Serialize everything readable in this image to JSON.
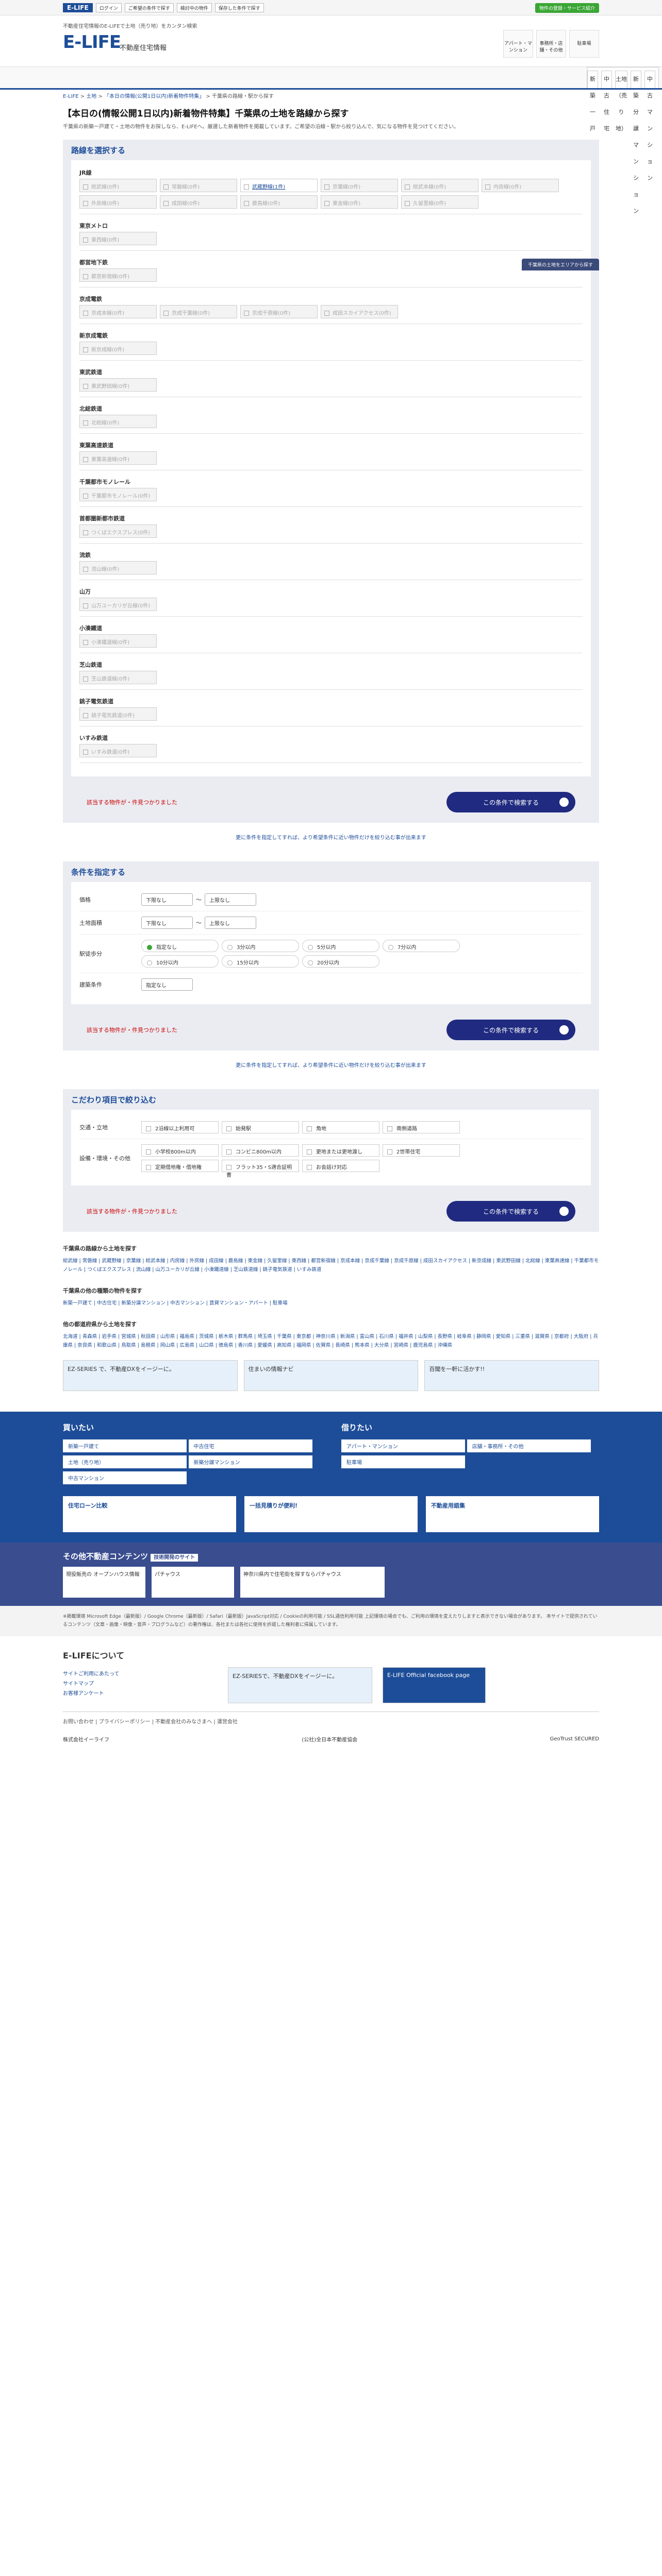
{
  "topbar": {
    "logo": "E-LIFE",
    "btn1": "ログイン",
    "btn2": "ご希望の条件で探す",
    "btn3": "検討中の物件",
    "btn4": "保存した条件で探す",
    "right": "物件の登録・サービス紹介"
  },
  "header": {
    "desc": "不動産住宅情報のE-LIFEで土地（売り地）をカンタン検索",
    "logo": "E-LIFE",
    "sub": "不動産住宅情報",
    "nav": [
      "アパート・マンション",
      "事務所・店舗・その他",
      "駐車場"
    ]
  },
  "gnav": [
    "新築一戸建て",
    "中古住宅",
    "土地（売り地）",
    "新築分譲マンション",
    "中古マンション"
  ],
  "breadcrumb": {
    "home": "E-LIFE",
    "b2": "土地",
    "b3": "「本日の情報(公開1日以内)新着物件特集」",
    "b4": "千葉県の路線・駅から探す"
  },
  "title": "【本日の(情報公開1日以内)新着物件特集】千葉県の土地を路線から探す",
  "lead": "千葉県の新築一戸建て・土地の物件をお探しなら、E-LIFEへ。厳選した新着物件を掲載しています。ご希望の沿線・駅から絞り込んで、気になる物件を見つけてください。",
  "area_link": "千葉県の土地をエリアから探す",
  "line_section": {
    "title": "路線を選択する",
    "lines": [
      {
        "name": "JR線",
        "stations": [
          "総武線(0件)",
          "常磐線(0件)",
          "武蔵野線(1件)",
          "京葉線(0件)",
          "総武本線(0件)",
          "内房線(0件)",
          "外房線(0件)",
          "成田線(0件)",
          "鹿島線(0件)",
          "東金線(0件)",
          "久留里線(0件)"
        ]
      },
      {
        "name": "東京メトロ",
        "stations": [
          "東西線(0件)"
        ]
      },
      {
        "name": "都営地下鉄",
        "stations": [
          "都営新宿線(0件)"
        ]
      },
      {
        "name": "京成電鉄",
        "stations": [
          "京成本線(0件)",
          "京成千葉線(0件)",
          "京成千原線(0件)",
          "成田スカイアクセス(0件)"
        ]
      },
      {
        "name": "新京成電鉄",
        "stations": [
          "新京成線(0件)"
        ]
      },
      {
        "name": "東武鉄道",
        "stations": [
          "東武野田線(0件)"
        ]
      },
      {
        "name": "北総鉄道",
        "stations": [
          "北総線(0件)"
        ]
      },
      {
        "name": "東葉高速鉄道",
        "stations": [
          "東葉高速線(0件)"
        ]
      },
      {
        "name": "千葉都市モノレール",
        "stations": [
          "千葉都市モノレール(0件)"
        ]
      },
      {
        "name": "首都圏新都市鉄道",
        "stations": [
          "つくばエクスプレス(0件)"
        ]
      },
      {
        "name": "流鉄",
        "stations": [
          "流山線(0件)"
        ]
      },
      {
        "name": "山万",
        "stations": [
          "山万ユーカリが丘線(0件)"
        ]
      },
      {
        "name": "小湊鐵道",
        "stations": [
          "小湊鐵道線(0件)"
        ]
      },
      {
        "name": "芝山鉄道",
        "stations": [
          "芝山鉄道線(0件)"
        ]
      },
      {
        "name": "銚子電気鉄道",
        "stations": [
          "銚子電気鉄道(0件)"
        ]
      },
      {
        "name": "いすみ鉄道",
        "stations": [
          "いすみ鉄道(0件)"
        ]
      }
    ]
  },
  "result_text": "該当する物件が・件見つかりました",
  "search_btn": "この条件で検索する",
  "hint": "更に条件を指定してすれば、より希望条件に近い物件だけを絞り込む事が出来ます",
  "cond_section": {
    "title": "条件を指定する",
    "price_label": "価格",
    "price_from": "下限なし",
    "price_to": "上限なし",
    "area_label": "土地面積",
    "area_from": "下限なし",
    "area_to": "上限なし",
    "walk_label": "駅徒歩分",
    "walk_options": [
      "指定なし",
      "3分以内",
      "5分以内",
      "7分以内",
      "10分以内",
      "15分以内",
      "20分以内"
    ],
    "build_label": "建築条件",
    "build_val": "指定なし"
  },
  "kodawari": {
    "title": "こだわり項目で絞り込む",
    "label1": "交通・立地",
    "items1": [
      "2沿線以上利用可",
      "始発駅",
      "角地",
      "南側道路"
    ],
    "label2": "設備・環境・その他",
    "items2": [
      "小学校800m以内",
      "コンビニ800m以内",
      "更地または更地渡し",
      "2世帯住宅",
      "定期借地権・借地権",
      "フラット35・S適合証明書",
      "お会話け対応"
    ]
  },
  "links": {
    "h1": "千葉県の路線から土地を探す",
    "p1": "総武線 | 常磐線 | 武蔵野線 | 京葉線 | 総武本線 | 内房線 | 外房線 | 成田線 | 鹿島線 | 東金線 | 久留里線 | 東西線 | 都営新宿線 | 京成本線 | 京成千葉線 | 京成千原線 | 成田スカイアクセス | 新京成線 | 東武野田線 | 北総線 | 東葉高速線 | 千葉都市モノレール | つくばエクスプレス | 流山線 | 山万ユーカリが丘線 | 小湊鐵道線 | 芝山鉄道線 | 銚子電気鉄道 | いすみ鉄道",
    "h2": "千葉県の他の種類の物件を探す",
    "p2": "新築一戸建て | 中古住宅 | 新築分譲マンション | 中古マンション | 賃貸マンション・アパート | 駐車場",
    "h3": "他の都道府県から土地を探す",
    "p3": "北海道 | 青森県 | 岩手県 | 宮城県 | 秋田県 | 山形県 | 福島県 | 茨城県 | 栃木県 | 群馬県 | 埼玉県 | 千葉県 | 東京都 | 神奈川県 | 新潟県 | 富山県 | 石川県 | 福井県 | 山梨県 | 長野県 | 岐阜県 | 静岡県 | 愛知県 | 三重県 | 滋賀県 | 京都府 | 大阪府 | 兵庫県 | 奈良県 | 和歌山県 | 鳥取県 | 島根県 | 岡山県 | 広島県 | 山口県 | 徳島県 | 香川県 | 愛媛県 | 高知県 | 福岡県 | 佐賀県 | 長崎県 | 熊本県 | 大分県 | 宮崎県 | 鹿児島県 | 沖縄県"
  },
  "banners": [
    "EZ-SERIES で、不動産DXをイージーに。",
    "住まいの情報ナビ",
    "百聞を一軒に活かす!!"
  ],
  "footer": {
    "buy_title": "買いたい",
    "buy": [
      "新築一戸建て",
      "中古住宅",
      "土地（売り地）",
      "新築分譲マンション",
      "中古マンション"
    ],
    "rent_title": "借りたい",
    "rent": [
      "アパート・マンション",
      "店舗・事務所・その他",
      "駐車場"
    ],
    "ads": [
      "住宅ローン比較",
      "一括見積りが便利!",
      "不動産用語集"
    ]
  },
  "other": {
    "title": "その他不動産コンテンツ",
    "tag": "技術開発のサイト",
    "items": [
      "現役販売の オープンハウス情報",
      "パチャウス",
      "神奈川県内で住宅街を探すならパチャウス"
    ]
  },
  "notes": "※掲載環境 Microsoft Edge（最新版）/ Google Chrome（最新版）/ Safari（最新版）JavaScript対応 / Cookieの利用可能 / SSL通信利用可能 上記環境の場合でも、ご利用の環境を変えたりしますと表示できない場合があります。 本サイトで提供されているコンテンツ（文章・画像・映像・音声・プログラムなど）の著作権は、各社または各社に使用を許諾した権利者に帰属しています。",
  "about": {
    "title": "E-LIFEについて",
    "items": [
      "サイトご利用にあたって",
      "サイトマップ",
      "お客様アンケート"
    ],
    "banner1": "EZ-SERIESで、不動産DXをイージーに。",
    "banner2": "E-LIFE Official facebook page"
  },
  "bottom_links": "お問い合わせ | プライバシーポリシー | 不動産会社のみなさまへ | 運営会社",
  "company": "株式会社イーライフ",
  "seals": [
    "(公社)全日本不動産協会",
    "GeoTrust SECURED"
  ]
}
